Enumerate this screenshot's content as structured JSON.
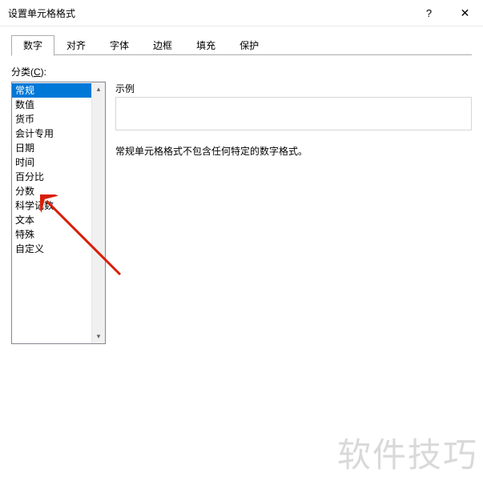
{
  "window": {
    "title": "设置单元格格式",
    "help_symbol": "?",
    "close_symbol": "✕"
  },
  "tabs": [
    {
      "label": "数字",
      "active": true
    },
    {
      "label": "对齐",
      "active": false
    },
    {
      "label": "字体",
      "active": false
    },
    {
      "label": "边框",
      "active": false
    },
    {
      "label": "填充",
      "active": false
    },
    {
      "label": "保护",
      "active": false
    }
  ],
  "category": {
    "label_prefix": "分类(",
    "label_hotkey": "C",
    "label_suffix": "):",
    "items": [
      "常规",
      "数值",
      "货币",
      "会计专用",
      "日期",
      "时间",
      "百分比",
      "分数",
      "科学记数",
      "文本",
      "特殊",
      "自定义"
    ],
    "selected_index": 0
  },
  "sample": {
    "label": "示例",
    "value": ""
  },
  "description": "常规单元格格式不包含任何特定的数字格式。",
  "watermark": "软件技巧"
}
